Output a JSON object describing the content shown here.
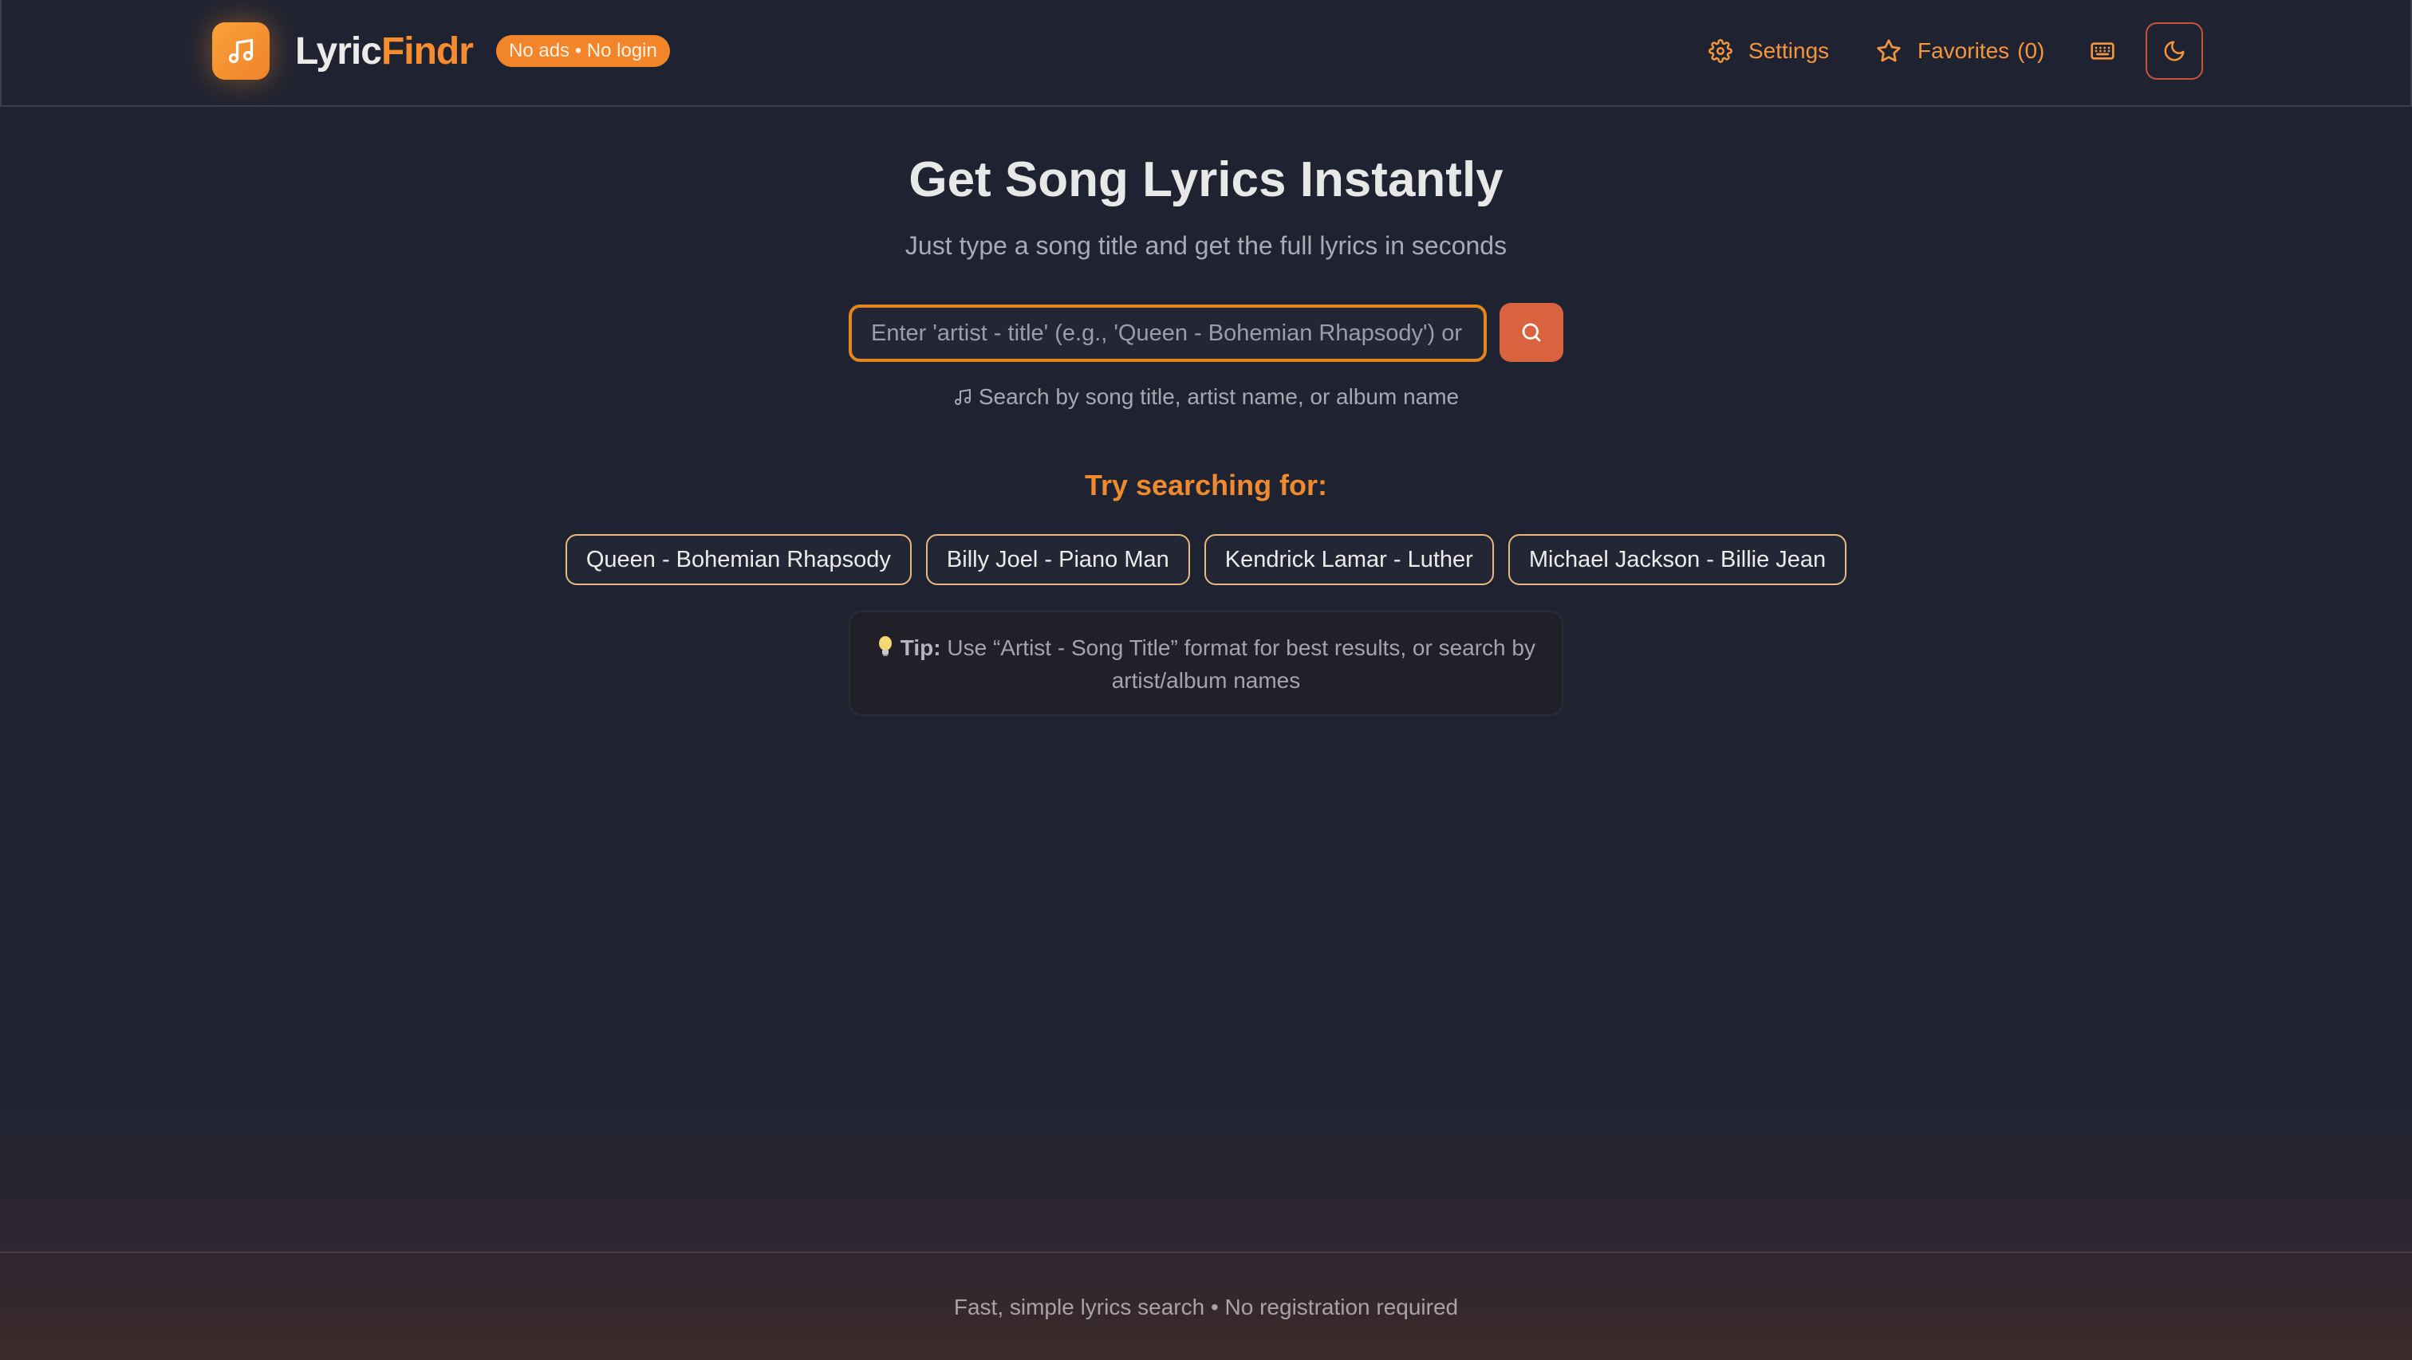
{
  "header": {
    "logo_icon": "music-note-icon",
    "brand_part1": "Lyric",
    "brand_part2": "Findr",
    "badge": "No ads • No login",
    "settings_label": "Settings",
    "favorites_label": "Favorites",
    "favorites_count": "(0)",
    "keyboard_icon": "keyboard-icon",
    "theme_icon": "moon-icon"
  },
  "hero": {
    "title": "Get Song Lyrics Instantly",
    "subtitle": "Just type a song title and get the full lyrics in seconds"
  },
  "search": {
    "placeholder": "Enter 'artist - title' (e.g., 'Queen - Bohemian Rhapsody') or search by song",
    "value": "",
    "hint": "Search by song title, artist name, or album name"
  },
  "suggestions": {
    "title": "Try searching for:",
    "items": [
      "Queen - Bohemian Rhapsody",
      "Billy Joel - Piano Man",
      "Kendrick Lamar - Luther",
      "Michael Jackson - Billie Jean"
    ]
  },
  "tip": {
    "label": "Tip:",
    "text": "Use “Artist - Song Title” format for best results, or search by artist/album names"
  },
  "footer": {
    "text": "Fast, simple lyrics search • No registration required"
  },
  "colors": {
    "background": "#1f2331",
    "accent": "#f58d2f",
    "search_button": "#d9633f"
  }
}
